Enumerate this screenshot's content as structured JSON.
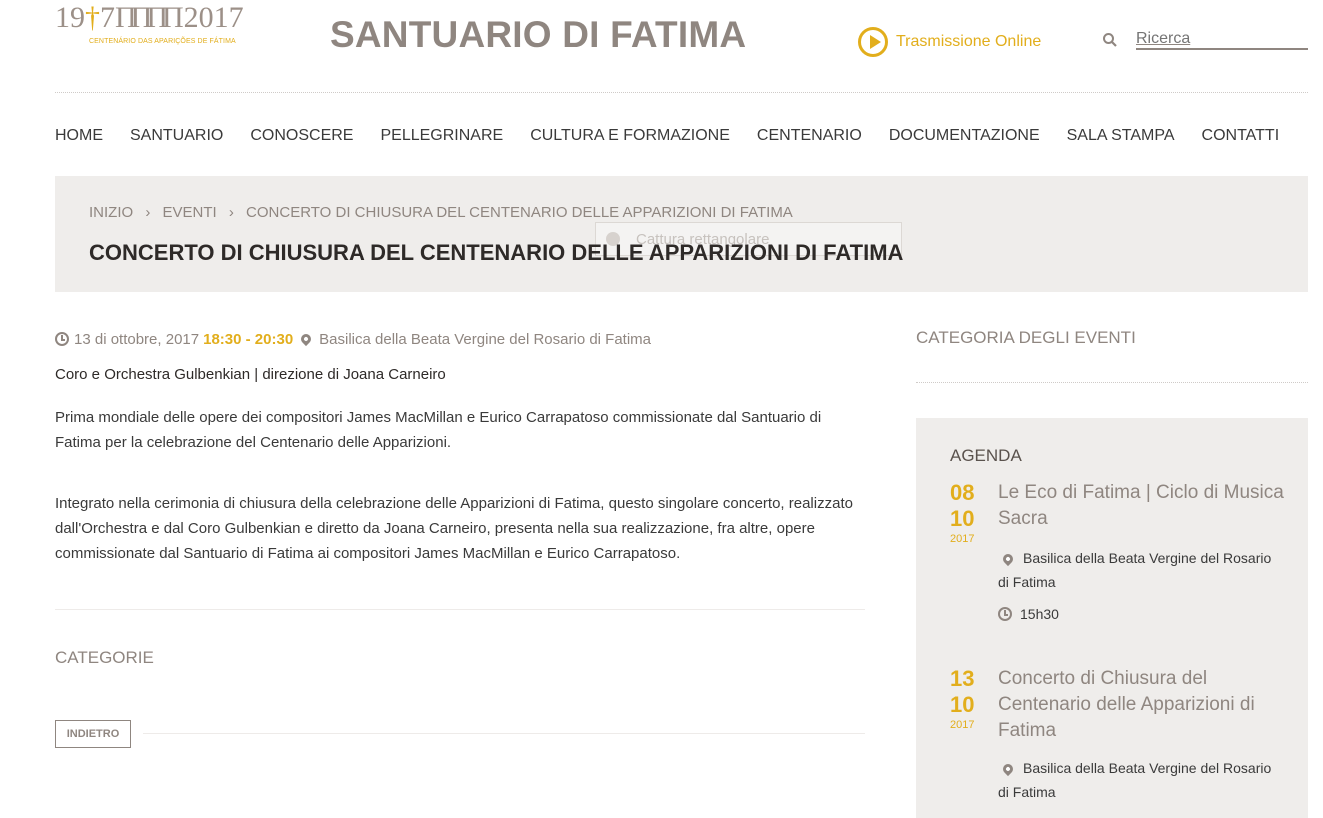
{
  "header": {
    "logo": {
      "text_left": "19",
      "cross": "†",
      "text_mid": "7",
      "columns": "ΠΠΠΠ",
      "text_right": "2017",
      "subtitle": "CENTENÁRIO DAS APARIÇÕES DE FÁTIMA"
    },
    "site_title": "SANTUARIO DI FATIMA",
    "live_label": "Trasmissione Online",
    "search_placeholder": "Ricerca"
  },
  "nav": {
    "items": [
      "HOME",
      "SANTUARIO",
      "CONOSCERE",
      "PELLEGRINARE",
      "CULTURA E FORMAZIONE",
      "CENTENARIO",
      "DOCUMENTAZIONE",
      "SALA STAMPA",
      "CONTATTI"
    ]
  },
  "breadcrumb": {
    "items": [
      "INIZIO",
      "EVENTI",
      "CONCERTO DI CHIUSURA DEL CENTENARIO DELLE APPARIZIONI DI FATIMA"
    ],
    "separator": "›"
  },
  "page_title": "CONCERTO DI CHIUSURA DEL CENTENARIO DELLE APPARIZIONI DI FATIMA",
  "overlay_tip": "Cattura rettangolare",
  "event": {
    "date": "13 di ottobre, 2017",
    "time": "18:30 - 20:30",
    "location": "Basilica della Beata Vergine del Rosario di Fatima",
    "subtitle": "Coro e Orchestra Gulbenkian | direzione di Joana Carneiro",
    "paragraph1": "Prima mondiale delle opere dei compositori James MacMillan e Eurico Carrapatoso commissionate dal Santuario di Fatima per la celebrazione del Centenario delle Apparizioni.",
    "paragraph2": "Integrato nella cerimonia di chiusura della celebrazione delle Apparizioni di Fatima, questo singolare concerto, realizzato dall'Orchestra e dal Coro Gulbenkian e diretto da Joana Carneiro, presenta nella sua realizzazione, fra altre, opere commissionate dal Santuario di Fatima ai compositori James MacMillan e Eurico Carrapatoso."
  },
  "categorie_label": "CATEGORIE",
  "back_label": "INDIETRO",
  "sidebar": {
    "category_title": "CATEGORIA DEGLI EVENTI",
    "agenda_title": "AGENDA",
    "events": [
      {
        "day": "08",
        "month": "10",
        "year": "2017",
        "title": "Le Eco di Fatima | Ciclo di Musica Sacra",
        "location": "Basilica della Beata Vergine del Rosario di Fatima",
        "time": "15h30"
      },
      {
        "day": "13",
        "month": "10",
        "year": "2017",
        "title": "Concerto di Chiusura del Centenario delle Apparizioni di Fatima",
        "location": "Basilica della Beata Vergine del Rosario di Fatima",
        "time": ""
      }
    ]
  },
  "colors": {
    "accent": "#e2ae1c",
    "muted": "#8f8680",
    "panel": "#efedeb",
    "text": "#3a3a3a"
  }
}
